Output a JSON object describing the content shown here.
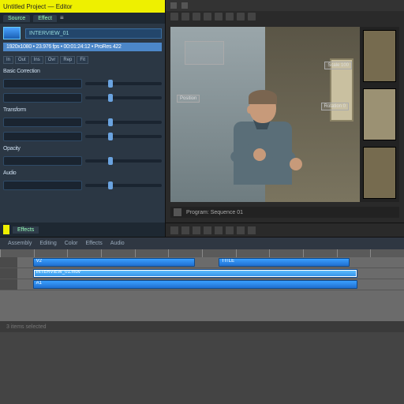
{
  "left": {
    "title": "Untitled Project — Editor",
    "tabs": [
      "Source",
      "Effect"
    ],
    "clip_label": "INTERVIEW_01",
    "info_bar": "1920x1080 • 23.976 fps • 00:01:24:12 • ProRes 422",
    "mini_buttons": [
      "In",
      "Out",
      "Ins",
      "Ovr",
      "Rep",
      "Fit"
    ],
    "sections": [
      {
        "head": "Basic Correction",
        "rows": 2
      },
      {
        "head": "Transform",
        "rows": 2
      },
      {
        "head": "Opacity",
        "rows": 1
      },
      {
        "head": "Audio",
        "rows": 1
      }
    ],
    "bottom_tab": "Effects"
  },
  "viewer": {
    "overlays": [
      "",
      "Scale 100",
      "Position",
      "Rotation 0"
    ],
    "footer": "Program: Sequence 01",
    "toolbar_slots": 10
  },
  "mid": {
    "items": [
      "Assembly",
      "Editing",
      "Color",
      "Effects",
      "Audio"
    ]
  },
  "timeline": {
    "ruler_ticks": 12,
    "tracks": [
      {
        "clips": [
          {
            "l": 4,
            "w": 42,
            "label": "V2",
            "sel": false
          },
          {
            "l": 52,
            "w": 34,
            "label": "TITLE",
            "sel": false
          }
        ]
      },
      {
        "clips": [
          {
            "l": 4,
            "w": 84,
            "label": "INTERVIEW_01.mov",
            "sel": true
          }
        ]
      },
      {
        "clips": [
          {
            "l": 4,
            "w": 84,
            "label": "A1",
            "sel": false
          }
        ]
      }
    ]
  },
  "status": "3 items selected"
}
